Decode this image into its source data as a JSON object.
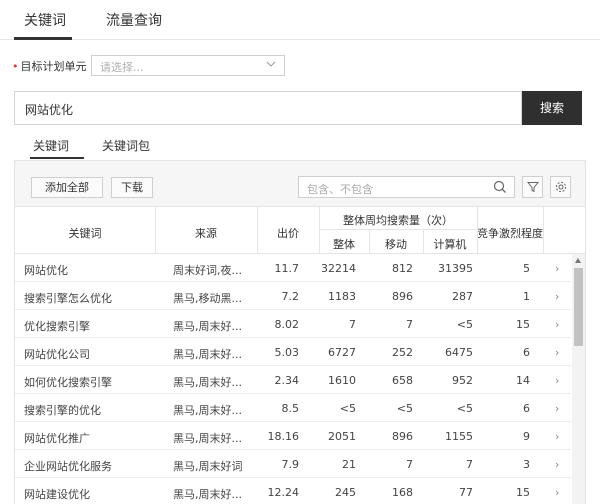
{
  "top_tabs": {
    "keyword": "关键词",
    "traffic": "流量查询"
  },
  "plan": {
    "label": "目标计划单元",
    "placeholder": "请选择..."
  },
  "search": {
    "value": "网站优化",
    "button": "搜索"
  },
  "sub_tabs": {
    "keyword": "关键词",
    "package": "关键词包"
  },
  "toolbar": {
    "add_all": "添加全部",
    "download": "下载",
    "filter_placeholder": "包含、不包含"
  },
  "table": {
    "headers": {
      "keyword": "关键词",
      "source": "来源",
      "bid": "出价",
      "weekly_search": "整体周均搜索量（次）",
      "overall": "整体",
      "mobile": "移动",
      "computer": "计算机",
      "competition": "竞争激烈程度"
    },
    "rows": [
      {
        "keyword": "网站优化",
        "source": "周末好词,夜...",
        "bid": "11.7",
        "overall": "32214",
        "mobile": "812",
        "computer": "31395",
        "competition": "5"
      },
      {
        "keyword": "搜索引擎怎么优化",
        "source": "黑马,移动黑...",
        "bid": "7.2",
        "overall": "1183",
        "mobile": "896",
        "computer": "287",
        "competition": "1"
      },
      {
        "keyword": "优化搜索引擎",
        "source": "黑马,周末好...",
        "bid": "8.02",
        "overall": "7",
        "mobile": "7",
        "computer": "<5",
        "competition": "15"
      },
      {
        "keyword": "网站优化公司",
        "source": "黑马,周末好...",
        "bid": "5.03",
        "overall": "6727",
        "mobile": "252",
        "computer": "6475",
        "competition": "6"
      },
      {
        "keyword": "如何优化搜索引擎",
        "source": "黑马,周末好...",
        "bid": "2.34",
        "overall": "1610",
        "mobile": "658",
        "computer": "952",
        "competition": "14"
      },
      {
        "keyword": "搜索引擎的优化",
        "source": "黑马,周末好...",
        "bid": "8.5",
        "overall": "<5",
        "mobile": "<5",
        "computer": "<5",
        "competition": "6"
      },
      {
        "keyword": "网站优化推广",
        "source": "黑马,周末好...",
        "bid": "18.16",
        "overall": "2051",
        "mobile": "896",
        "computer": "1155",
        "competition": "9"
      },
      {
        "keyword": "企业网站优化服务",
        "source": "黑马,周末好词",
        "bid": "7.9",
        "overall": "21",
        "mobile": "7",
        "computer": "7",
        "competition": "3"
      },
      {
        "keyword": "网站建设优化",
        "source": "黑马,周末好...",
        "bid": "12.24",
        "overall": "245",
        "mobile": "168",
        "computer": "77",
        "competition": "15"
      }
    ]
  },
  "icons": [
    "search-icon",
    "filter-icon",
    "gear-icon",
    "chevron-down-icon",
    "chevron-right-icon"
  ]
}
